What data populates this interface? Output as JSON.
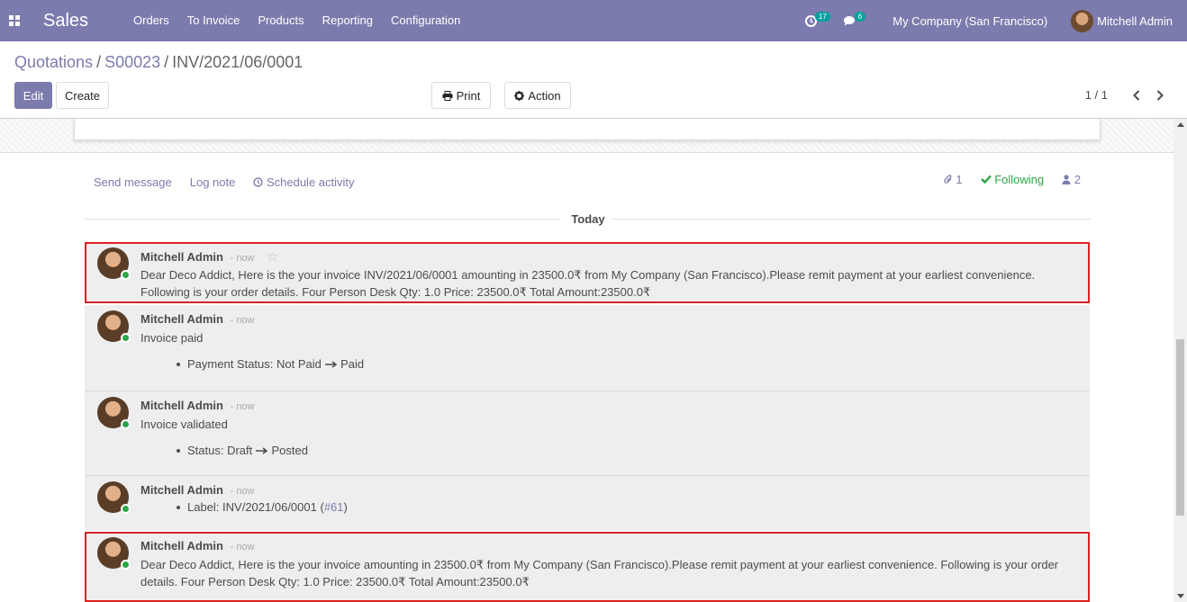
{
  "navbar": {
    "app_name": "Sales",
    "menu": [
      "Orders",
      "To Invoice",
      "Products",
      "Reporting",
      "Configuration"
    ],
    "activity_count": "17",
    "message_count": "6",
    "company": "My Company (San Francisco)",
    "user": "Mitchell Admin"
  },
  "breadcrumb": {
    "items": [
      "Quotations",
      "S00023"
    ],
    "current": "INV/2021/06/0001",
    "separator": "/"
  },
  "toolbar": {
    "edit_label": "Edit",
    "create_label": "Create",
    "print_label": "Print",
    "action_label": "Action",
    "pager_value": "1 / 1"
  },
  "chatter": {
    "send_message": "Send message",
    "log_note": "Log note",
    "schedule_activity": "Schedule activity",
    "attachment_count": "1",
    "following": "Following",
    "follower_count": "2",
    "date_separator": "Today"
  },
  "messages": [
    {
      "author": "Mitchell Admin",
      "date": "- now",
      "body": "Dear Deco Addict, Here is the your invoice INV/2021/06/0001 amounting in 23500.0₹ from My Company (San Francisco).Please remit payment at your earliest convenience. Following is your order details. Four Person Desk Qty: 1.0 Price: 23500.0₹ Total Amount:23500.0₹"
    },
    {
      "author": "Mitchell Admin",
      "date": "- now",
      "body": "Invoice paid",
      "tracking_label": "Payment Status:",
      "tracking_old": "Not Paid",
      "tracking_new": "Paid"
    },
    {
      "author": "Mitchell Admin",
      "date": "- now",
      "body": "Invoice validated",
      "tracking_label": "Status:",
      "tracking_old": "Draft",
      "tracking_new": "Posted"
    },
    {
      "author": "Mitchell Admin",
      "date": "- now",
      "tracking_label": "Label:",
      "tracking_value": "INV/2021/06/0001",
      "tracking_paren_open": "(",
      "tracking_link": "#61",
      "tracking_paren_close": ")"
    },
    {
      "author": "Mitchell Admin",
      "date": "- now",
      "body": "Dear Deco Addict, Here is the your invoice amounting in 23500.0₹ from My Company (San Francisco).Please remit payment at your earliest convenience. Following is your order details. Four Person Desk Qty: 1.0 Price: 23500.0₹ Total Amount:23500.0₹"
    }
  ],
  "colors": {
    "brand": "#7c7bad",
    "highlight": "#dd2222",
    "message_bg": "#eeeeee",
    "online": "#28a745",
    "following": "#28a745"
  }
}
